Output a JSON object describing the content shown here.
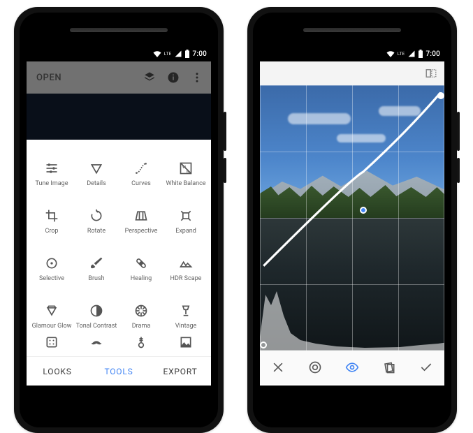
{
  "status": {
    "lte": "LTE",
    "time": "7:00"
  },
  "phoneA": {
    "header": {
      "open_label": "OPEN"
    },
    "tools": [
      {
        "id": "tune",
        "label": "Tune Image"
      },
      {
        "id": "details",
        "label": "Details"
      },
      {
        "id": "curves",
        "label": "Curves"
      },
      {
        "id": "wb",
        "label": "White Balance"
      },
      {
        "id": "crop",
        "label": "Crop"
      },
      {
        "id": "rotate",
        "label": "Rotate"
      },
      {
        "id": "perspective",
        "label": "Perspective"
      },
      {
        "id": "expand",
        "label": "Expand"
      },
      {
        "id": "selective",
        "label": "Selective"
      },
      {
        "id": "brush",
        "label": "Brush"
      },
      {
        "id": "healing",
        "label": "Healing"
      },
      {
        "id": "hdr",
        "label": "HDR Scape"
      },
      {
        "id": "glamour",
        "label": "Glamour Glow"
      },
      {
        "id": "tonal",
        "label": "Tonal Contrast"
      },
      {
        "id": "drama",
        "label": "Drama"
      },
      {
        "id": "vintage",
        "label": "Vintage"
      }
    ],
    "tabs": {
      "looks": "LOOKS",
      "tools": "TOOLS",
      "export": "EXPORT",
      "active": "tools"
    }
  },
  "phoneB": {
    "curve_points": [
      {
        "x": 0.02,
        "y": 0.98,
        "style": "open"
      },
      {
        "x": 0.56,
        "y": 0.47,
        "style": "blue"
      },
      {
        "x": 0.98,
        "y": 0.04,
        "style": "solid"
      }
    ],
    "grid_divisions": 4,
    "bottom_actions": [
      {
        "id": "cancel",
        "icon": "close-icon"
      },
      {
        "id": "channel",
        "icon": "contrast-circle-icon"
      },
      {
        "id": "preview",
        "icon": "eye-icon",
        "active": true
      },
      {
        "id": "presets",
        "icon": "cards-icon"
      },
      {
        "id": "apply",
        "icon": "check-icon"
      }
    ]
  }
}
